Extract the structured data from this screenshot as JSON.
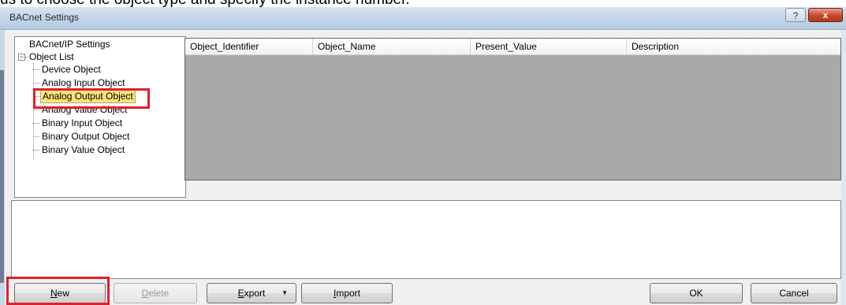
{
  "caption": "us to choose the object type and specify the instance number.",
  "window": {
    "title": "BACnet Settings",
    "help_label": "?",
    "close_label": "x"
  },
  "tree": {
    "root_label": "BACnet/IP Settings",
    "group_label": "Object List",
    "expander": "−",
    "items": [
      "Device Object",
      "Analog Input Object",
      "Analog Output Object",
      "Analog Value Object",
      "Binary Input Object",
      "Binary Output Object",
      "Binary Value Object"
    ],
    "selected_index": 2
  },
  "grid": {
    "columns": [
      "Object_Identifier",
      "Object_Name",
      "Present_Value",
      "Description"
    ]
  },
  "buttons": {
    "new_prefix": "N",
    "new_rest": "ew",
    "delete_prefix": "D",
    "delete_rest": "elete",
    "export_prefix": "E",
    "export_rest": "xport",
    "export_arrow": "▼",
    "import_prefix": "I",
    "import_rest": "mport",
    "ok": "OK",
    "cancel": "Cancel"
  },
  "colors": {
    "highlight": "#e0202a",
    "selection": "#fbe37a",
    "grid_bg": "#a9a9a9"
  }
}
